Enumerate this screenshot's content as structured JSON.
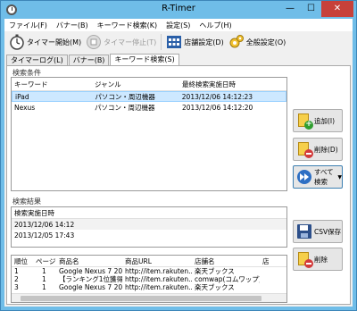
{
  "window": {
    "title": "R-Timer",
    "minimize": "—",
    "maximize": "☐",
    "close": "✕"
  },
  "menu": [
    {
      "label": "ファイル(F)"
    },
    {
      "label": "バナー(B)"
    },
    {
      "label": "キーワード検索(K)"
    },
    {
      "label": "設定(S)"
    },
    {
      "label": "ヘルプ(H)"
    }
  ],
  "toolbar": {
    "start_label": "タイマー開始(M)",
    "stop_label": "タイマー停止(T)",
    "shop_settings_label": "店舗設定(D)",
    "all_settings_label": "全般設定(O)"
  },
  "tabs": [
    {
      "label": "タイマーログ(L)"
    },
    {
      "label": "バナー(B)"
    },
    {
      "label": "キーワード検索(S)"
    }
  ],
  "conditions": {
    "section_title": "検索条件",
    "columns": [
      "キーワード",
      "ジャンル",
      "最終検索実施日時"
    ],
    "rows": [
      {
        "keyword": "iPad",
        "genre": "パソコン・周辺機器",
        "last": "2013/12/06 14:12:23"
      },
      {
        "keyword": "Nexus",
        "genre": "パソコン・周辺機器",
        "last": "2013/12/06 14:12:20"
      }
    ],
    "add_label": "追加(I)",
    "delete_label": "削除(D)",
    "search_all_label": "すべて検索"
  },
  "results": {
    "section_title": "検索結果",
    "dates_header": "検索実施日時",
    "dates": [
      "2013/12/06 14:12",
      "2013/12/05 17:43"
    ],
    "csv_label": "CSV保存",
    "delete_label": "削除",
    "columns": [
      "順位",
      "ページ",
      "商品名",
      "商品URL",
      "店舗名",
      "店"
    ],
    "rows": [
      {
        "rank": "1",
        "page": "1",
        "name": "Google Nexus 7 20...",
        "url": "http://item.rakuten...",
        "shop": "楽天ブックス"
      },
      {
        "rank": "2",
        "page": "1",
        "name": "【ランキング1位獲得...",
        "url": "http://item.rakuten...",
        "shop": "comwap(コムワップ)"
      },
      {
        "rank": "3",
        "page": "1",
        "name": "Google Nexus 7 20...",
        "url": "http://item.rakuten...",
        "shop": "楽天ブックス"
      }
    ]
  }
}
